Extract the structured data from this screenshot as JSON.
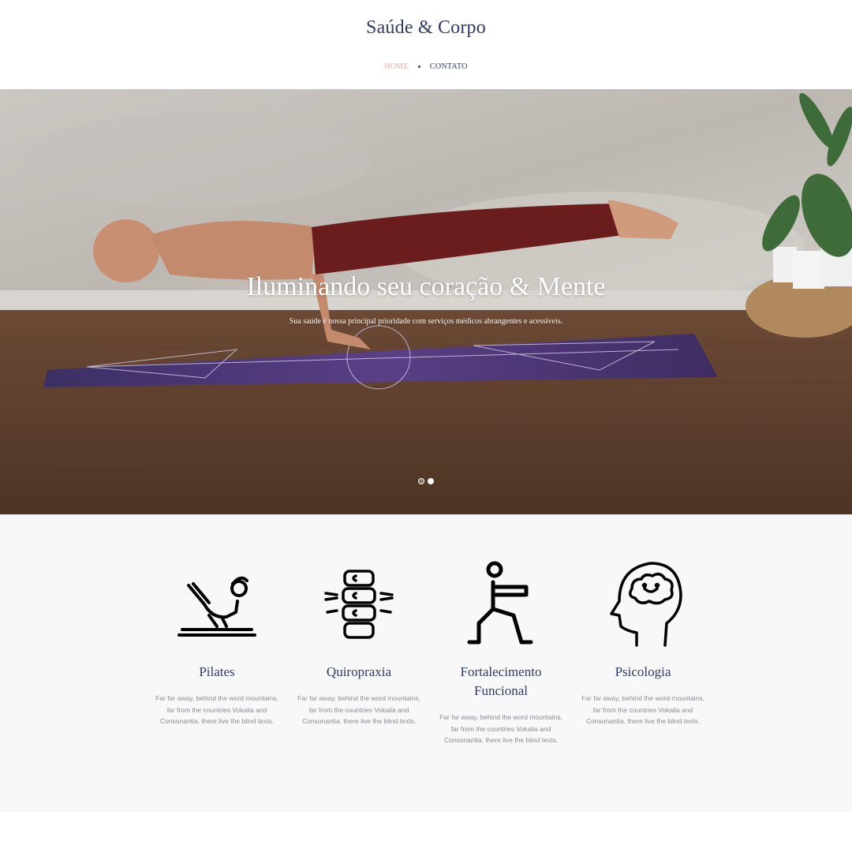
{
  "header": {
    "brand": "Saúde & Corpo",
    "nav": [
      {
        "label": "HOME",
        "active": true
      },
      {
        "label": "CONTATO",
        "active": false
      }
    ]
  },
  "hero": {
    "title": "Iluminando seu coração & Mente",
    "subtitle": "Sua saúde é nossa principal prioridade com serviços médicos abrangentes e acessíveis.",
    "slides": 2,
    "current_slide": 2
  },
  "services": [
    {
      "icon": "pilates-icon",
      "name": "Pilates",
      "desc": "Far far away, behind the word mountains, far from the countries Vokalia and Consonantia, there live the blind texts."
    },
    {
      "icon": "spine-icon",
      "name": "Quiropraxia",
      "desc": "Far far away, behind the word mountains, far from the countries Vokalia and Consonantia, there live the blind texts."
    },
    {
      "icon": "lunge-exercise-icon",
      "name": "Fortalecimento Funcional",
      "desc": "Far far away, behind the word mountains, far from the countries Vokalia and Consonantia, there live the blind texts."
    },
    {
      "icon": "head-brain-icon",
      "name": "Psicologia",
      "desc": "Far far away, behind the word mountains, far from the countries Vokalia and Consonantia, there live the blind texts."
    }
  ],
  "colors": {
    "brand_navy": "#2f3a66",
    "nav_active": "#f0a8a2",
    "text_muted": "#8a8a95",
    "section_bg": "#f8f8f8"
  }
}
